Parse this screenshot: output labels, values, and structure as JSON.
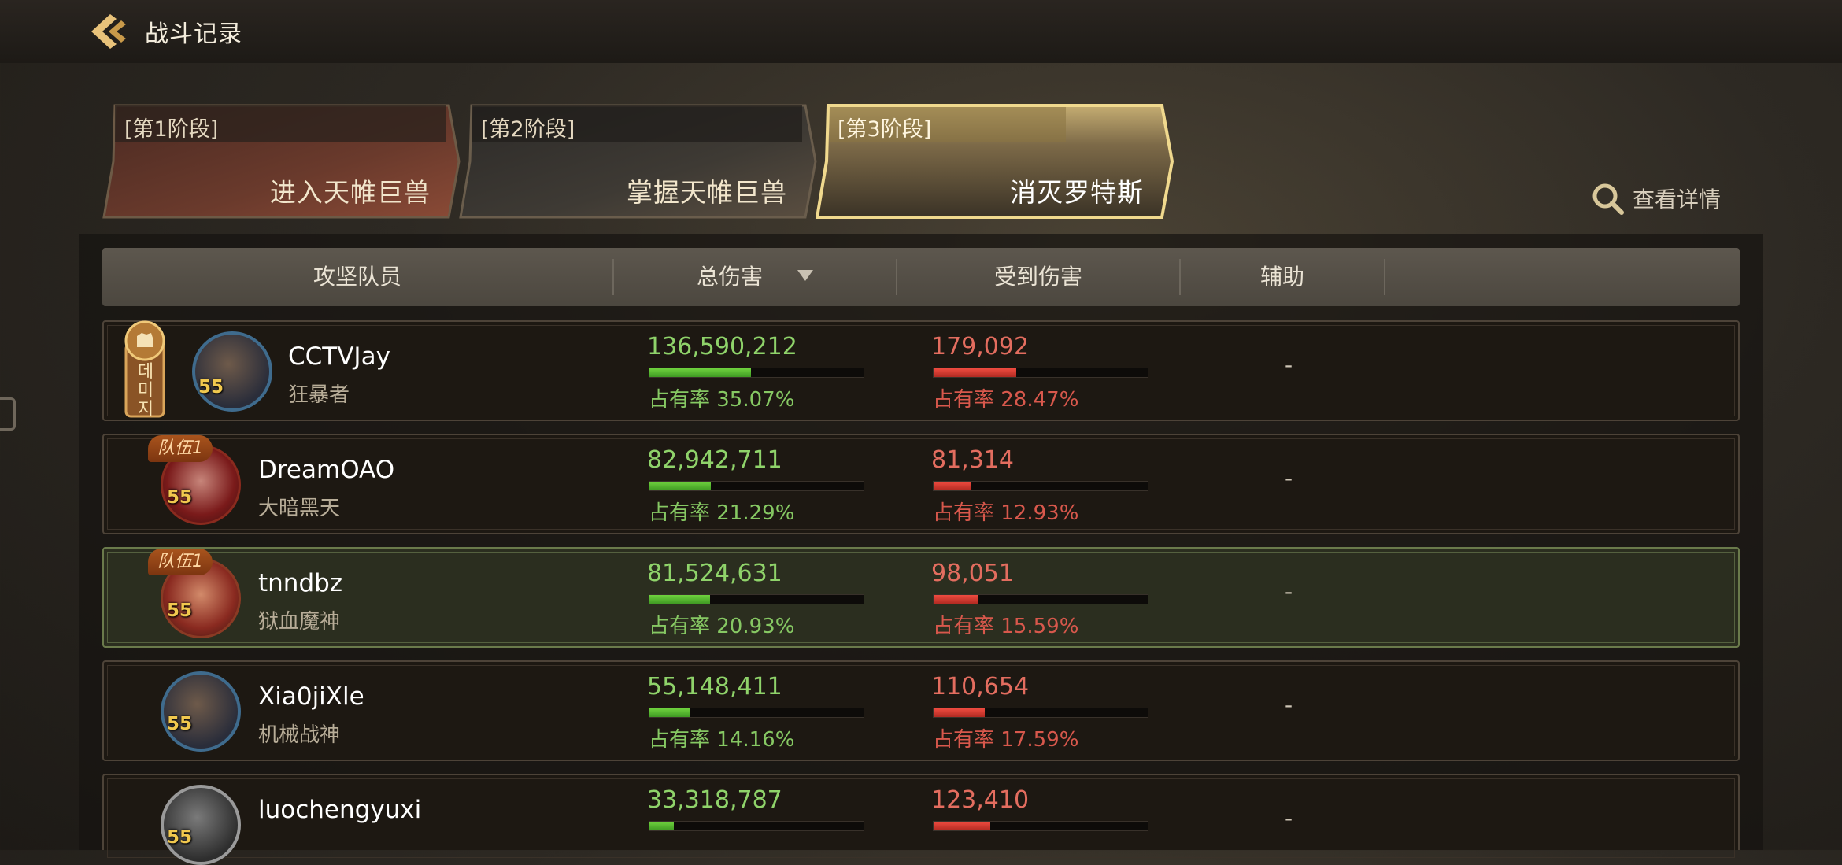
{
  "header": {
    "title": "战斗记录"
  },
  "stages": [
    {
      "tag": "[第1阶段]",
      "name": "进入天帷巨兽",
      "active": false
    },
    {
      "tag": "[第2阶段]",
      "name": "掌握天帷巨兽",
      "active": false
    },
    {
      "tag": "[第3阶段]",
      "name": "消灭罗特斯",
      "active": true
    }
  ],
  "detail_label": "查看详情",
  "columns": {
    "member": "攻坚队员",
    "total_damage": "总伤害",
    "damage_taken": "受到伤害",
    "assist": "辅助"
  },
  "players": [
    {
      "name": "CCTVJay",
      "class": "狂暴者",
      "level": "55",
      "badge": "",
      "medal": "데미지",
      "damage": "136,590,212",
      "damage_share": "占有率 35.07%",
      "damage_frac": 0.3507,
      "taken": "179,092",
      "taken_share": "占有率 28.47%",
      "taken_frac": 0.2847,
      "assist": "-"
    },
    {
      "name": "DreamOAO",
      "class": "大暗黑天",
      "level": "55",
      "badge": "队伍1",
      "medal": "",
      "damage": "82,942,711",
      "damage_share": "占有率 21.29%",
      "damage_frac": 0.2129,
      "taken": "81,314",
      "taken_share": "占有率 12.93%",
      "taken_frac": 0.1293,
      "assist": "-"
    },
    {
      "name": "tnndbz",
      "class": "狱血魔神",
      "level": "55",
      "badge": "队伍1",
      "medal": "",
      "damage": "81,524,631",
      "damage_share": "占有率 20.93%",
      "damage_frac": 0.2093,
      "taken": "98,051",
      "taken_share": "占有率 15.59%",
      "taken_frac": 0.1559,
      "assist": "-"
    },
    {
      "name": "Xia0jiXle",
      "class": "机械战神",
      "level": "55",
      "badge": "",
      "medal": "",
      "damage": "55,148,411",
      "damage_share": "占有率 14.16%",
      "damage_frac": 0.1416,
      "taken": "110,654",
      "taken_share": "占有率 17.59%",
      "taken_frac": 0.1759,
      "assist": "-"
    },
    {
      "name": "luochengyuxi",
      "class": "",
      "level": "55",
      "badge": "",
      "medal": "",
      "damage": "33,318,787",
      "damage_share": "",
      "damage_frac": 0.085,
      "taken": "123,410",
      "taken_share": "",
      "taken_frac": 0.197,
      "assist": "-"
    }
  ],
  "colors": {
    "accent_green": "#8fd36a",
    "accent_red": "#e36d5f",
    "highlight_row": "#2b2e1f"
  }
}
